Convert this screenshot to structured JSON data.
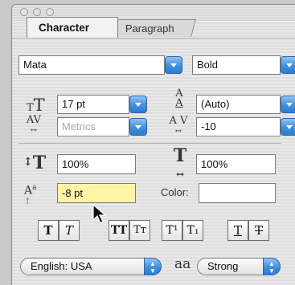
{
  "window": {
    "traffic_lights": [
      "close",
      "minimize",
      "zoom"
    ]
  },
  "tabs": {
    "active": "Character",
    "inactive": "Paragraph"
  },
  "font": {
    "family": "Mata",
    "style": "Bold"
  },
  "size": {
    "value": "17 pt",
    "icon": "font-size-icon"
  },
  "leading": {
    "value": "(Auto)",
    "icon": "leading-icon"
  },
  "kerning": {
    "value": "Metrics",
    "icon": "kerning-icon"
  },
  "tracking": {
    "value": "-10",
    "icon": "tracking-icon"
  },
  "vertical_scale": {
    "value": "100%",
    "icon": "vertical-scale-icon"
  },
  "horizontal_scale": {
    "value": "100%",
    "icon": "horizontal-scale-icon"
  },
  "baseline_shift": {
    "value": "-8 pt",
    "icon": "baseline-shift-icon"
  },
  "color": {
    "label": "Color:",
    "swatch": "#ffffff"
  },
  "style_buttons": [
    {
      "name": "faux-bold",
      "glyph": "T"
    },
    {
      "name": "faux-italic",
      "glyph": "T"
    },
    {
      "name": "all-caps",
      "glyph": "TT"
    },
    {
      "name": "small-caps",
      "glyph": "Tт"
    },
    {
      "name": "superscript",
      "glyph": "T¹"
    },
    {
      "name": "subscript",
      "glyph": "T₁"
    },
    {
      "name": "underline",
      "glyph": "T"
    },
    {
      "name": "strikethrough",
      "glyph": "T"
    }
  ],
  "language": {
    "value": "English: USA"
  },
  "antialias": {
    "icon_text": "aa",
    "value": "Strong"
  },
  "colors": {
    "accent": "#3f8fdc",
    "highlight": "#fff3a8"
  }
}
